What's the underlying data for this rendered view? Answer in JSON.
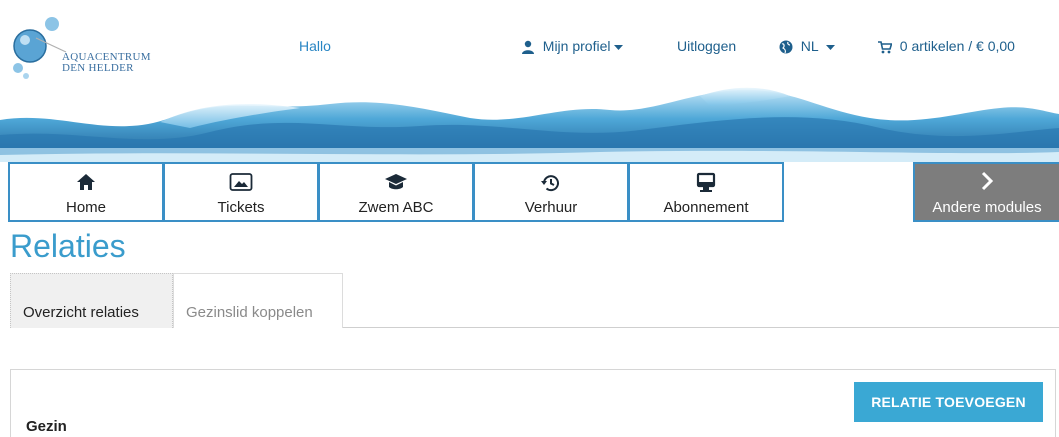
{
  "brand": {
    "name_line1": "AQUACENTRUM",
    "name_line2": "DEN HELDER",
    "primary_color": "#3a9ccc",
    "button_color": "#3aa8d4"
  },
  "topbar": {
    "greeting": "Hallo",
    "profile_label": "Mijn profiel",
    "logout_label": "Uitloggen",
    "language": "NL",
    "cart_label": "0 artikelen / € 0,00"
  },
  "modules": [
    {
      "label": "Home",
      "icon": "home-icon"
    },
    {
      "label": "Tickets",
      "icon": "image-icon"
    },
    {
      "label": "Zwem ABC",
      "icon": "graduation-cap-icon"
    },
    {
      "label": "Verhuur",
      "icon": "history-icon"
    },
    {
      "label": "Abonnement",
      "icon": "monitor-icon"
    }
  ],
  "other_modules": {
    "label": "Andere modules",
    "icon": "chevron-right-icon"
  },
  "page": {
    "title": "Relaties",
    "tabs": [
      {
        "label": "Overzicht relaties",
        "active": true
      },
      {
        "label": "Gezinslid koppelen",
        "active": false
      }
    ],
    "panel": {
      "title": "Gezin",
      "add_button": "RELATIE TOEVOEGEN"
    }
  }
}
